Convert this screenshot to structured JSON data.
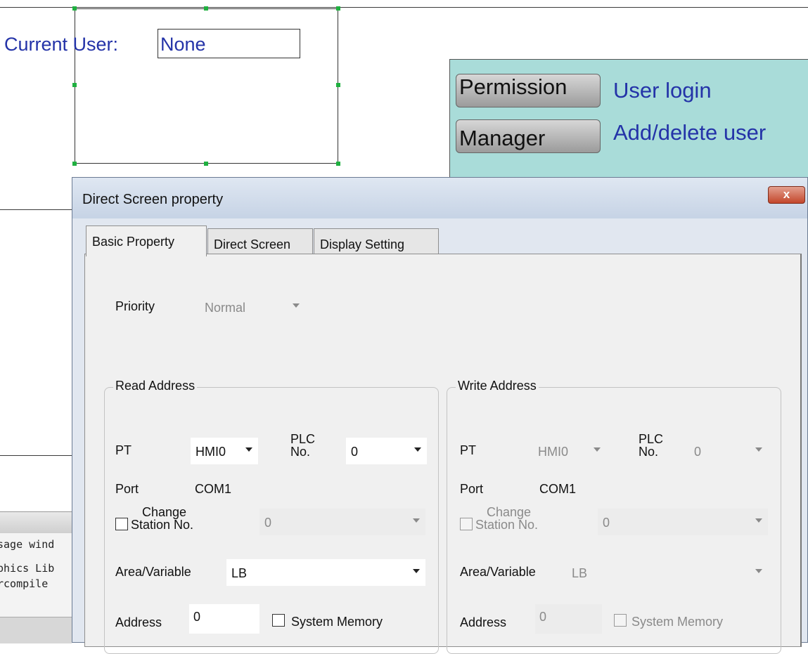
{
  "canvas": {
    "current_user_label": "Current User:",
    "current_user_value": "None",
    "buttons": [
      {
        "label": "Permission",
        "description": "User login"
      },
      {
        "label": "Manager",
        "description": "Add/delete user"
      }
    ],
    "message_lines": [
      "sage wind",
      "phics Lib",
      "rcompile"
    ]
  },
  "dialog": {
    "title": "Direct Screen property",
    "close_label": "x",
    "tabs": [
      "Basic Property",
      "Direct Screen",
      "Display Setting"
    ],
    "priority": {
      "label": "Priority",
      "value": "Normal"
    },
    "read": {
      "title": "Read Address",
      "pt_label": "PT",
      "pt_value": "HMI0",
      "plc_label_1": "PLC",
      "plc_label_2": "No.",
      "plc_value": "0",
      "port_label": "Port",
      "port_value": "COM1",
      "change_label_1": "Change",
      "change_label_2": "Station No.",
      "change_checked": false,
      "station_value": "0",
      "area_label": "Area/Variable",
      "area_value": "LB",
      "address_label": "Address",
      "address_value": "0",
      "system_memory_label": "System Memory",
      "system_memory_checked": false
    },
    "write": {
      "title": "Write Address",
      "pt_label": "PT",
      "pt_value": "HMI0",
      "plc_label_1": "PLC",
      "plc_label_2": "No.",
      "plc_value": "0",
      "port_label": "Port",
      "port_value": "COM1",
      "change_label_1": "Change",
      "change_label_2": "Station No.",
      "change_checked": false,
      "station_value": "0",
      "area_label": "Area/Variable",
      "area_value": "LB",
      "address_label": "Address",
      "address_value": "0",
      "system_memory_label": "System Memory",
      "system_memory_checked": false
    }
  },
  "colors": {
    "canvas_text": "#2433a8",
    "teal_panel": "#a9dcd9",
    "selection_handle": "#1fb040",
    "close_button": "#c3462b"
  }
}
